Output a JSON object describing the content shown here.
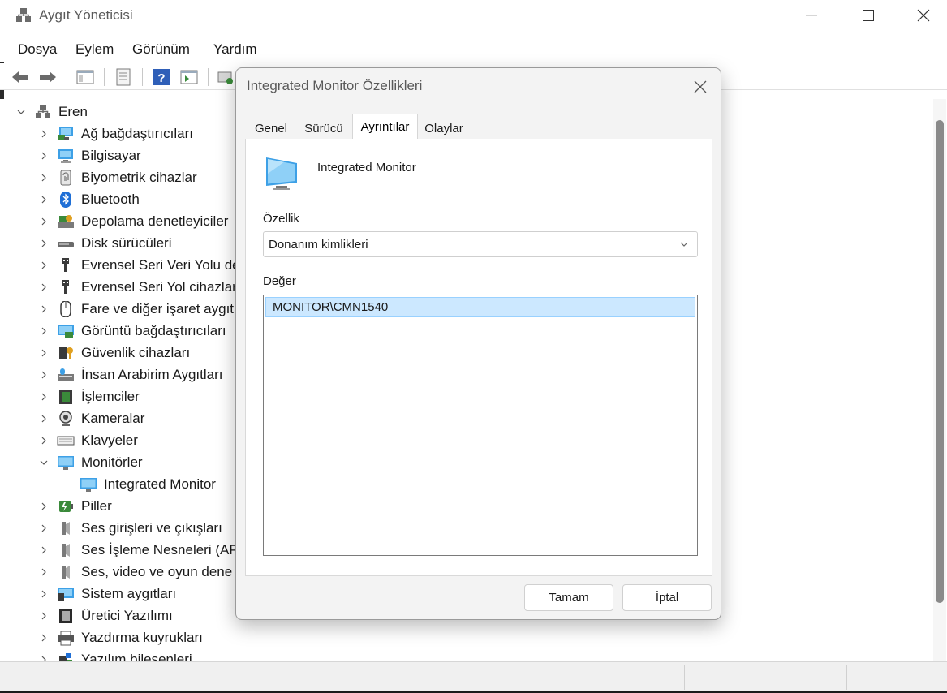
{
  "window": {
    "title": "Aygıt Yöneticisi",
    "title_color": "#5a5a5a"
  },
  "menu": [
    "Dosya",
    "Eylem",
    "Görünüm",
    "Yardım"
  ],
  "tree": {
    "root": "Eren",
    "items": [
      {
        "label": "Ağ bağdaştırıcıları",
        "icon": "network-adapter-icon"
      },
      {
        "label": "Bilgisayar",
        "icon": "computer-icon"
      },
      {
        "label": "Biyometrik cihazlar",
        "icon": "fingerprint-icon"
      },
      {
        "label": "Bluetooth",
        "icon": "bluetooth-icon"
      },
      {
        "label": "Depolama denetleyiciler",
        "icon": "storage-controller-icon"
      },
      {
        "label": "Disk sürücüleri",
        "icon": "disk-drive-icon"
      },
      {
        "label": "Evrensel Seri Veri Yolu de",
        "icon": "usb-icon"
      },
      {
        "label": "Evrensel Seri Yol cihazlar",
        "icon": "usb-icon"
      },
      {
        "label": "Fare ve diğer işaret aygıt",
        "icon": "mouse-icon"
      },
      {
        "label": "Görüntü bağdaştırıcıları",
        "icon": "display-adapter-icon"
      },
      {
        "label": "Güvenlik cihazları",
        "icon": "security-device-icon"
      },
      {
        "label": "İnsan Arabirim Aygıtları",
        "icon": "hid-icon"
      },
      {
        "label": "İşlemciler",
        "icon": "processor-icon"
      },
      {
        "label": "Kameralar",
        "icon": "camera-icon"
      },
      {
        "label": "Klavyeler",
        "icon": "keyboard-icon"
      },
      {
        "label": "Monitörler",
        "icon": "monitor-icon",
        "expanded": true
      },
      {
        "label": "Integrated Monitor",
        "icon": "monitor-icon",
        "child": true
      },
      {
        "label": "Piller",
        "icon": "battery-icon"
      },
      {
        "label": "Ses girişleri ve çıkışları",
        "icon": "speaker-icon"
      },
      {
        "label": "Ses İşleme Nesneleri (APO",
        "icon": "speaker-icon"
      },
      {
        "label": "Ses, video ve oyun dene",
        "icon": "speaker-icon"
      },
      {
        "label": "Sistem aygıtları",
        "icon": "system-device-icon"
      },
      {
        "label": "Üretici Yazılımı",
        "icon": "firmware-icon"
      },
      {
        "label": "Yazdırma kuyrukları",
        "icon": "printer-icon"
      },
      {
        "label": "Yazılım bileşenleri",
        "icon": "software-component-icon"
      }
    ]
  },
  "dialog": {
    "title": "Integrated Monitor Özellikleri",
    "tabs": [
      "Genel",
      "Sürücü",
      "Ayrıntılar",
      "Olaylar"
    ],
    "active_tab": "Ayrıntılar",
    "device_name": "Integrated Monitor",
    "property_label": "Özellik",
    "property_value": "Donanım kimlikleri",
    "value_label": "Değer",
    "values": [
      "MONITOR\\CMN1540"
    ],
    "ok": "Tamam",
    "cancel": "İptal"
  },
  "colors": {
    "selection": "#cce8ff",
    "accent": "#0078d4"
  }
}
